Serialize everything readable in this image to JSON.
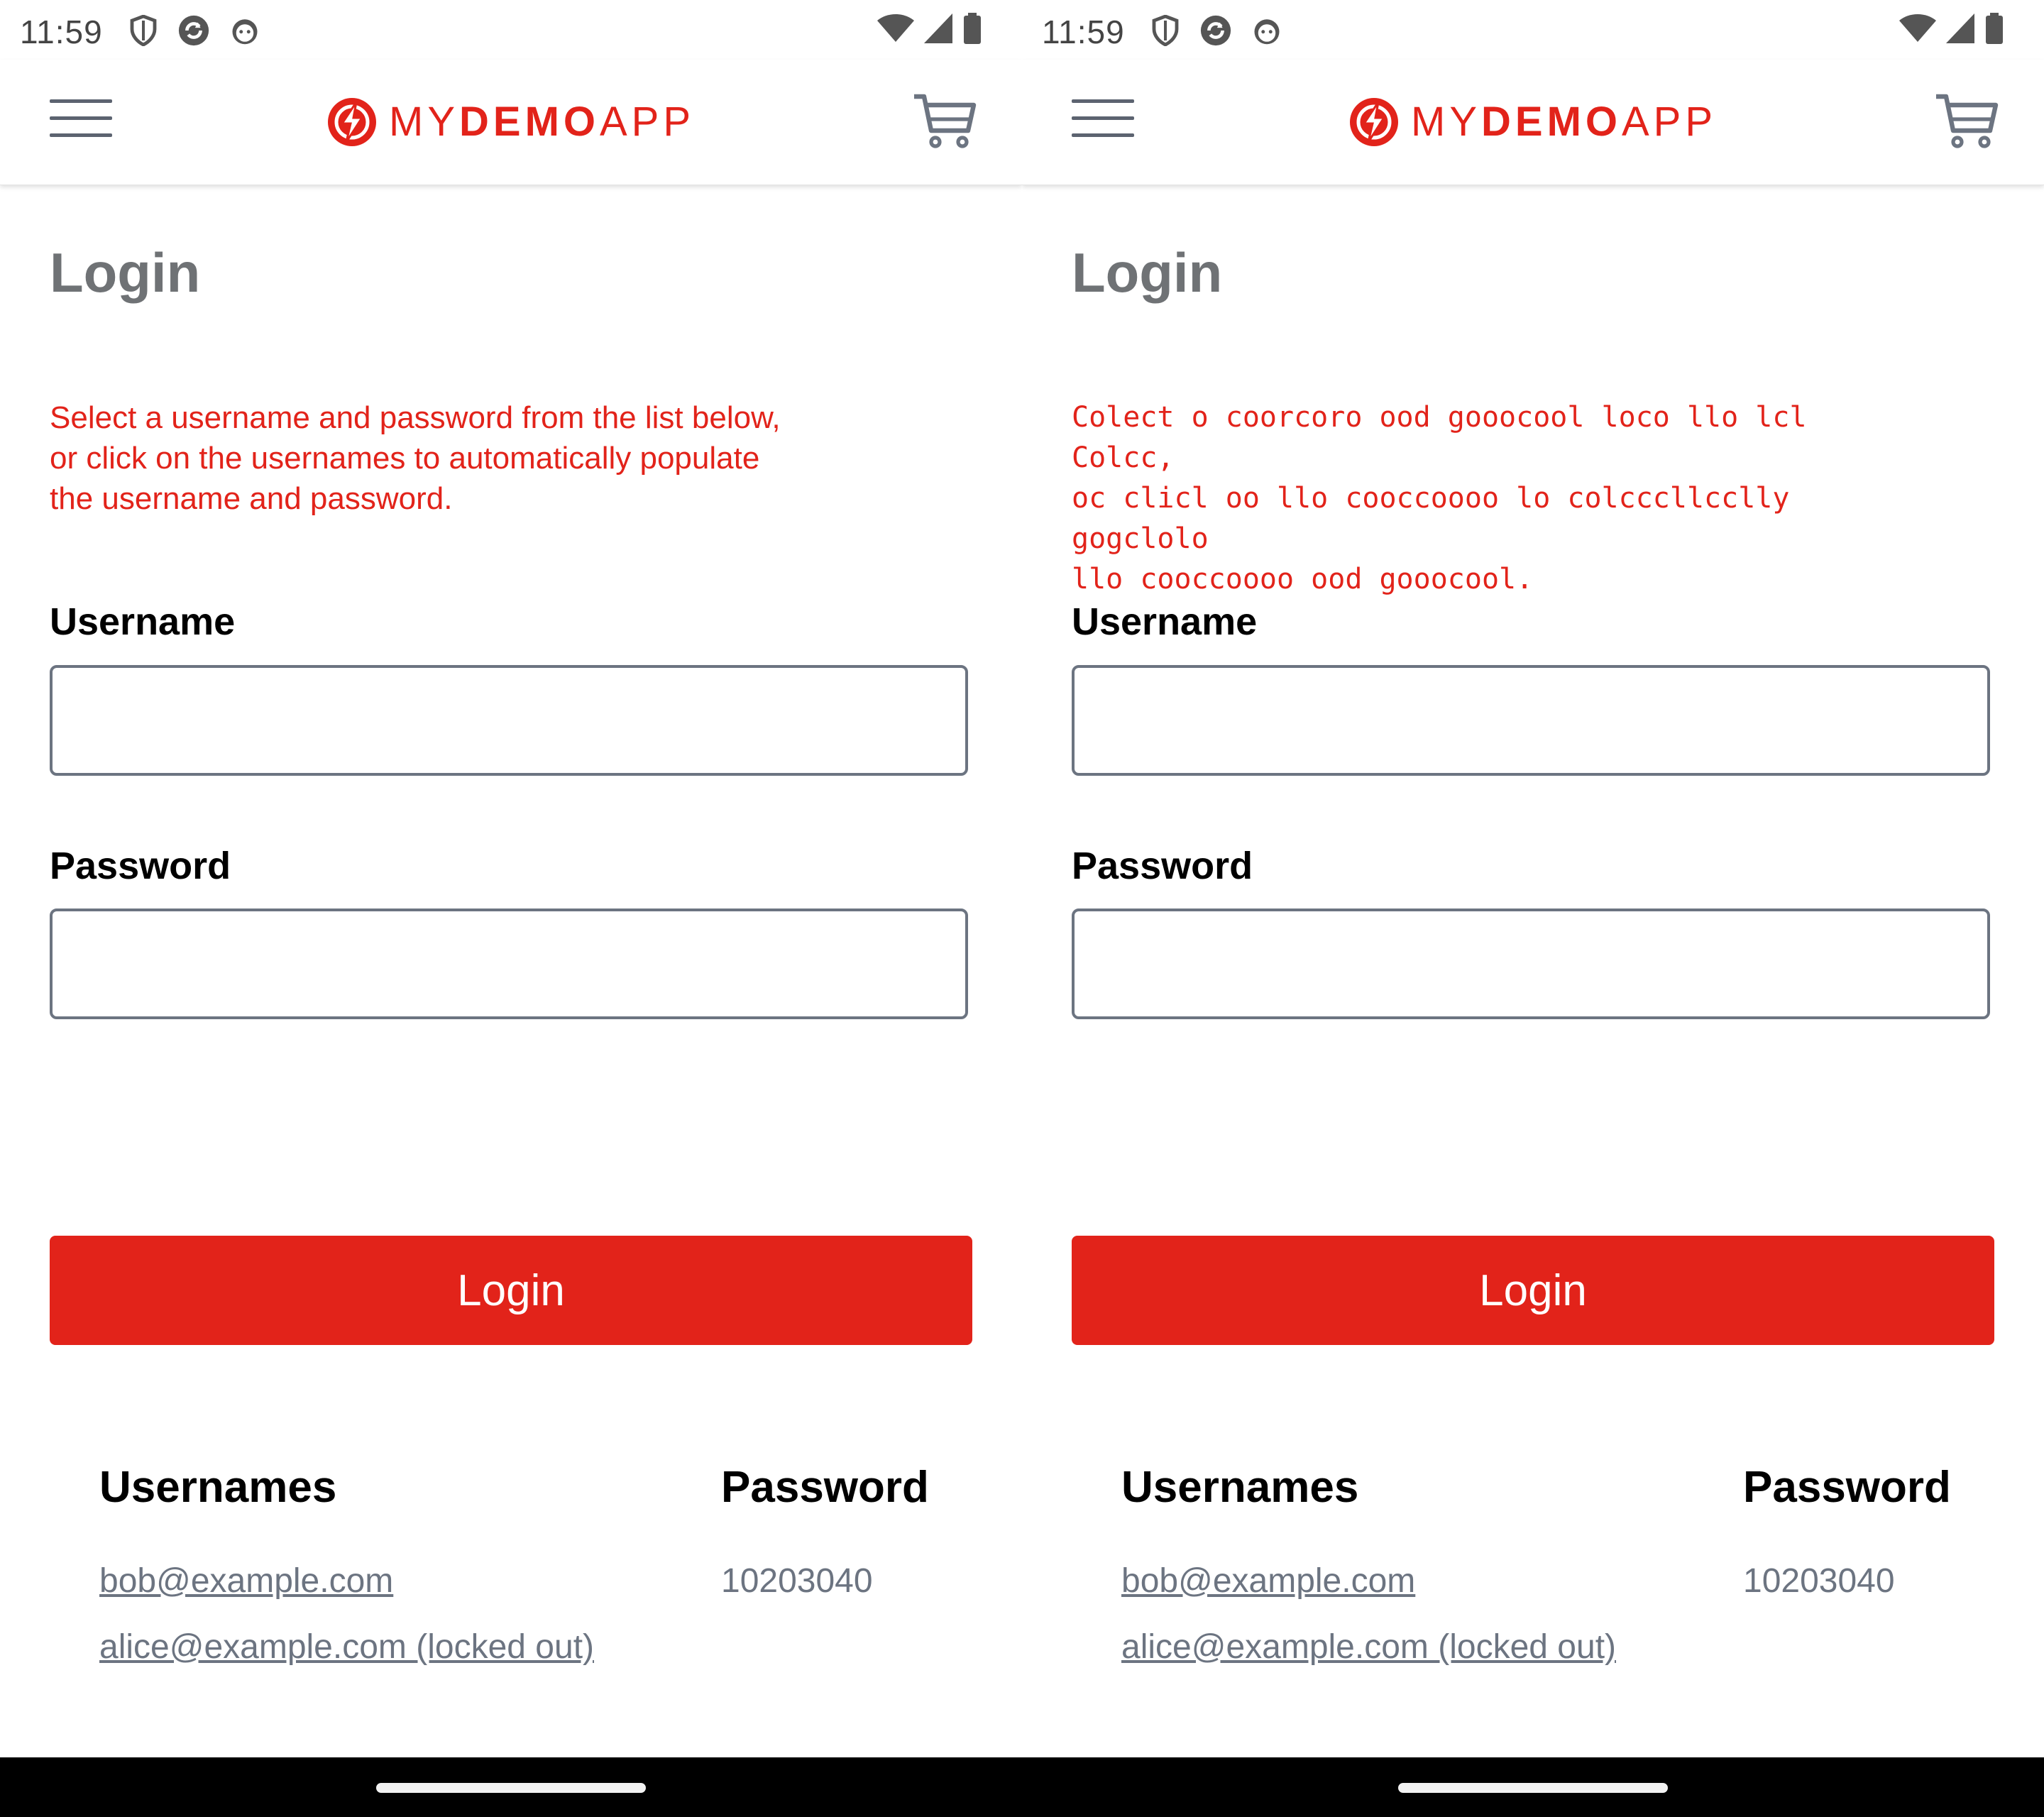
{
  "colors": {
    "brand_red": "#e2231a",
    "gray_text": "#6c7481",
    "title_gray": "#6f7275"
  },
  "left": {
    "status": {
      "time": "11:59",
      "icons": [
        "shield-icon",
        "sync-icon",
        "android-face-icon",
        "wifi-icon",
        "signal-icon",
        "battery-icon"
      ]
    },
    "header": {
      "menu_icon": "hamburger-menu-icon",
      "logo": {
        "my": "MY",
        "demo": "DEMO",
        "app": "APP"
      },
      "cart_icon": "cart-icon"
    },
    "title": "Login",
    "instructions": [
      "Select a username and password from the list below,",
      "or click on the usernames to automatically populate",
      "the username and password."
    ],
    "username": {
      "label": "Username",
      "value": "",
      "placeholder": ""
    },
    "password": {
      "label": "Password",
      "value": "",
      "placeholder": ""
    },
    "login_button": "Login",
    "credentials": {
      "usernames_header": "Usernames",
      "password_header": "Password",
      "users": [
        "bob@example.com",
        "alice@example.com (locked out)"
      ],
      "password": "10203040"
    }
  },
  "right": {
    "status": {
      "time": "11:59",
      "icons": [
        "shield-icon",
        "sync-icon",
        "android-face-icon",
        "wifi-icon",
        "signal-icon",
        "battery-icon"
      ]
    },
    "header": {
      "menu_icon": "hamburger-menu-icon",
      "logo": {
        "my": "MY",
        "demo": "DEMO",
        "app": "APP"
      },
      "cart_icon": "cart-icon"
    },
    "title": "Login",
    "instructions": [
      "Colect o coorcoro ood gooocool loco llo lcl Colcc,",
      "oc clicl oo llo cooccoooo lo colcccllcclly gogclolo",
      "llo cooccoooo ood gooocool."
    ],
    "username": {
      "label": "Username",
      "value": "",
      "placeholder": ""
    },
    "password": {
      "label": "Password",
      "value": "",
      "placeholder": ""
    },
    "login_button": "Login",
    "credentials": {
      "usernames_header": "Usernames",
      "password_header": "Password",
      "users": [
        "bob@example.com",
        "alice@example.com (locked out)"
      ],
      "password": "10203040"
    }
  }
}
